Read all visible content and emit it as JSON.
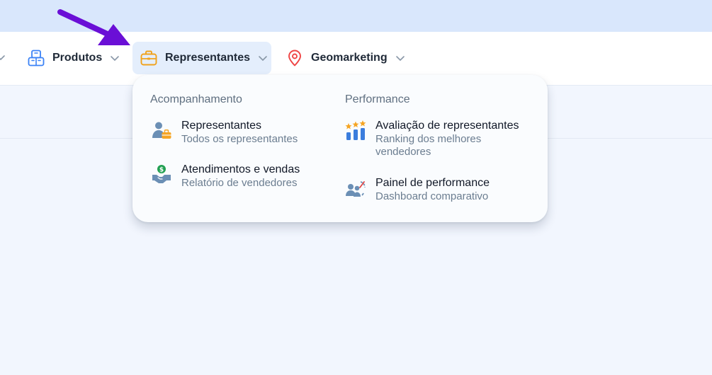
{
  "nav": {
    "items": [
      {
        "label": "Produtos",
        "icon": "box-icon"
      },
      {
        "label": "Representantes",
        "icon": "briefcase-icon",
        "active": true
      },
      {
        "label": "Geomarketing",
        "icon": "map-pin-icon"
      }
    ]
  },
  "dropdown": {
    "columns": [
      {
        "heading": "Acompanhamento",
        "entries": [
          {
            "title": "Representantes",
            "subtitle": "Todos os representantes",
            "icon": "sales-rep-icon"
          },
          {
            "title": "Atendimentos e vendas",
            "subtitle": "Relatório de vendedores",
            "icon": "money-handshake-icon"
          }
        ]
      },
      {
        "heading": "Performance",
        "entries": [
          {
            "title": "Avaliação de representantes",
            "subtitle": "Ranking dos melhores vendedores",
            "icon": "star-ranking-icon"
          },
          {
            "title": "Painel de performance",
            "subtitle": "Dashboard comparativo",
            "icon": "performance-dashboard-icon"
          }
        ]
      }
    ]
  },
  "colors": {
    "top_band": "#d9e7fc",
    "active_nav_bg": "#e4eefc",
    "arrow": "#6a0fd6",
    "briefcase": "#f0a21c",
    "map_pin": "#ef4444",
    "box_icon": "#3b82f6"
  }
}
